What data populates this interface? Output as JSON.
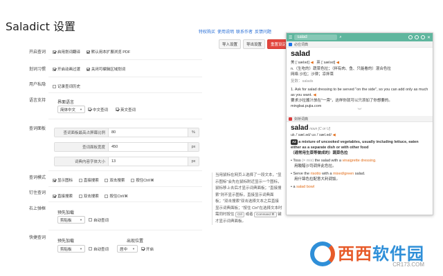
{
  "app": {
    "title": "Saladict 设置"
  },
  "top_links": [
    "特权购买",
    "使用说明",
    "联系作者",
    "反馈问题"
  ],
  "top_buttons": {
    "reset_label": "导入设置",
    "export_label": "导出设置",
    "default_label": "重置设定"
  },
  "rows": {
    "enable": {
      "label": "开启查词",
      "opts": [
        "启用划词翻译",
        "默认用本扩展浏览 PDF"
      ]
    },
    "habit": {
      "label": "划词习惯",
      "opts": [
        "开启动画过渡",
        "关闭可编辑区域划词"
      ]
    },
    "privacy": {
      "label": "用户私隐",
      "opts": [
        "记录查词历史"
      ]
    },
    "lang": {
      "label": "语言支持",
      "sub": "界面语言",
      "select": "简体中文",
      "opts": [
        "中文查词",
        "英文查词"
      ]
    },
    "panel": {
      "label": "查词面板",
      "fields": [
        {
          "label": "查词面板最高占屏幕比例",
          "value": "80",
          "unit": "%"
        },
        {
          "label": "查词面板宽度",
          "value": "450",
          "unit": "px"
        },
        {
          "label": "词典内容字体大小",
          "value": "13",
          "unit": "px"
        }
      ]
    },
    "mode": {
      "label": "查词模式",
      "opts": [
        "显示图标",
        "直接搜索",
        "双击搜索",
        "按住Ctrl/⌘"
      ]
    },
    "pin": {
      "label": "钉住查词",
      "opts": [
        "直接搜索",
        "双击搜索",
        "按住Ctrl/⌘"
      ]
    },
    "tripclick": {
      "label": "右上弹框",
      "sub": "预先加载",
      "select": "剪贴板",
      "opts": [
        "自动查词"
      ]
    },
    "quick": {
      "label": "快捷查词",
      "sub1": "预先加载",
      "select1": "剪贴板",
      "opts1": [
        "自动查词"
      ],
      "sub2": "出现位置",
      "select2": "居中",
      "opts2": [
        "开启"
      ]
    }
  },
  "help": {
    "text": "当用鼠标在网页上选择了一段文本，\"显示图标\"会先在鼠标附近显示一个图标，鼠标移上去后才显示词典面板；\"直接搜索\"则不显示图标，直接显示词典面板；\"双击搜索\"双击选择文本之后直接显示词典面板；\"按住 Ctrl\"在选择文本时需同时按住",
    "kbd1": "Ctrl",
    "mid": "或者",
    "kbd2": "Command ⌘",
    "tail": "键才显示词典面板。"
  },
  "dict_panel": {
    "search_word": "salad",
    "dict1": {
      "name": "必应词典",
      "headword": "salad",
      "phon_us": "美 [ˈsæləd]",
      "phon_uk": "英 [ˈsæləd]",
      "def_n": "n.（生吃的）蔬菜色拉；（拌有肉、鱼、只能看的）混合色拉",
      "def_web": "网络 沙拉；沙律；凉拌菜",
      "plural": "复数：salads",
      "ex_num": "1.",
      "ex_en": "Ask for salad dressing to be served \"on the side\", so you can add only as much as you want.",
      "ex_cn": "要求沙拉酱汁放在\"一旁\"，这样你就可以只添加了你想要的。",
      "ex_src": "mingbai.pujia.com"
    },
    "dict2": {
      "name": "剑桥词典",
      "headword": "salad",
      "pos": "noun [C or U]",
      "phon": "uk /ˈsæl.əd/  us /ˈsæl.əd/",
      "level": "A2",
      "def_en": "a mixture of uncooked vegetables, usually including lettuce, eaten either as a separate dish or with other food",
      "def_cn": "（通常用生菜等做成的）蔬菜色拉",
      "ex1_pre": "Toss",
      "ex1_hl": "(= mix)",
      "ex1_mid": "the salad with a",
      "ex1_kw": "vinaigrette dressing.",
      "ex1_cn": "用酸醋沙司调拌此色拉。",
      "ex2_pre": "Serve the",
      "ex2_kw": "risotto",
      "ex2_mid": "with a",
      "ex2_kw2": "mixed/green",
      "ex2_tail": "salad.",
      "ex2_cn": "用什锦色拉配意大利调饭。",
      "ex3_pre": "a",
      "ex3_kw": "salad bowl"
    }
  },
  "watermark": {
    "text_a": "西西",
    "text_b": "软件园",
    "url": "CR173.COM"
  },
  "colors": {
    "accent": "#5fb69e",
    "danger": "#e2463e",
    "link": "#2a6fd6",
    "watermark_orange": "#e75b2a",
    "watermark_blue": "#2f8fd8"
  }
}
